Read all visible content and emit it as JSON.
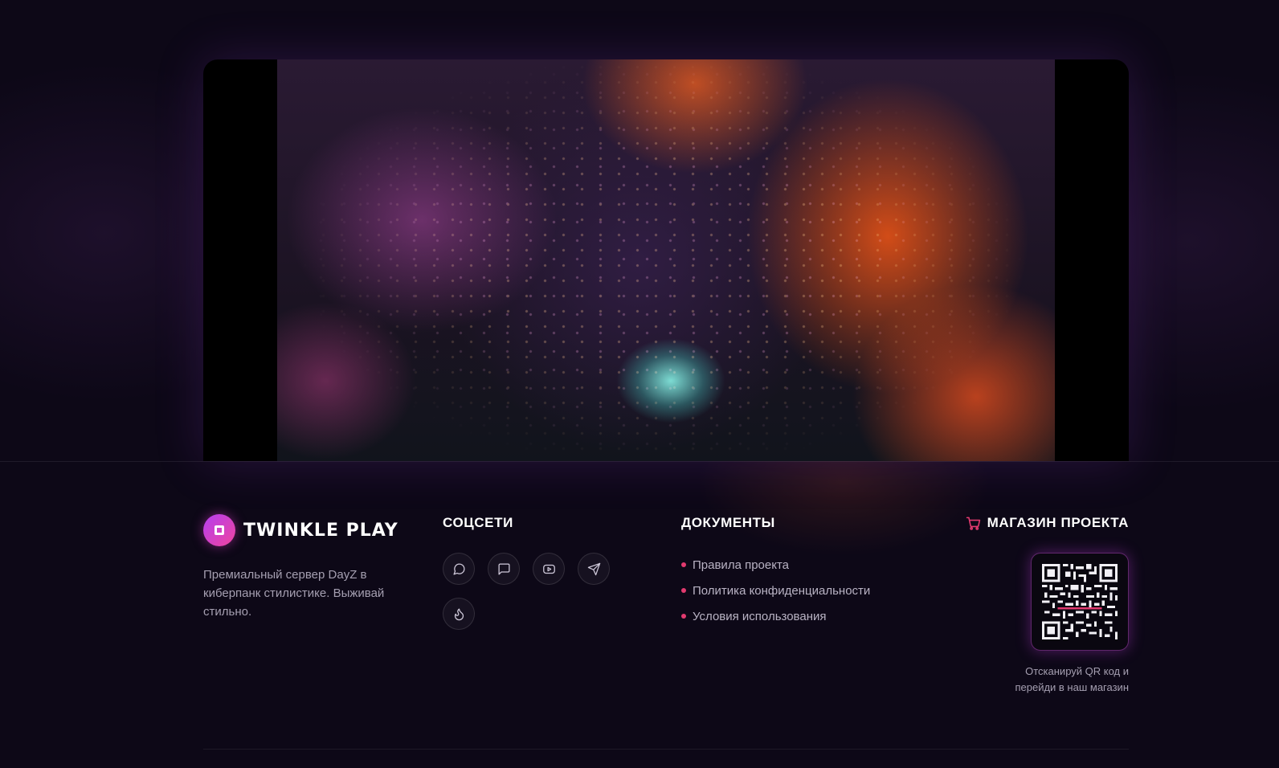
{
  "video": {
    "description_icon": "cyberpunk-city-video"
  },
  "brand": {
    "name": "TWINKLE PLAY",
    "description": "Премиальный сервер DayZ в киберпанк стилистике. Выживай стильно."
  },
  "social": {
    "title": "СОЦСЕТИ",
    "items": [
      {
        "icon": "chat-bubble-icon"
      },
      {
        "icon": "message-square-icon"
      },
      {
        "icon": "youtube-icon"
      },
      {
        "icon": "telegram-icon"
      },
      {
        "icon": "flame-icon"
      }
    ]
  },
  "documents": {
    "title": "ДОКУМЕНТЫ",
    "items": [
      {
        "label": "Правила проекта"
      },
      {
        "label": "Политика конфиденциальности"
      },
      {
        "label": "Условия использования"
      }
    ]
  },
  "shop": {
    "title": "МАГАЗИН ПРОЕКТА",
    "caption": "Отсканируй QR код и перейди в наш магазин"
  },
  "colors": {
    "accent": "#e23a6f",
    "brand_from": "#b43ff0",
    "brand_to": "#f0449e",
    "background": "#0d0817"
  }
}
